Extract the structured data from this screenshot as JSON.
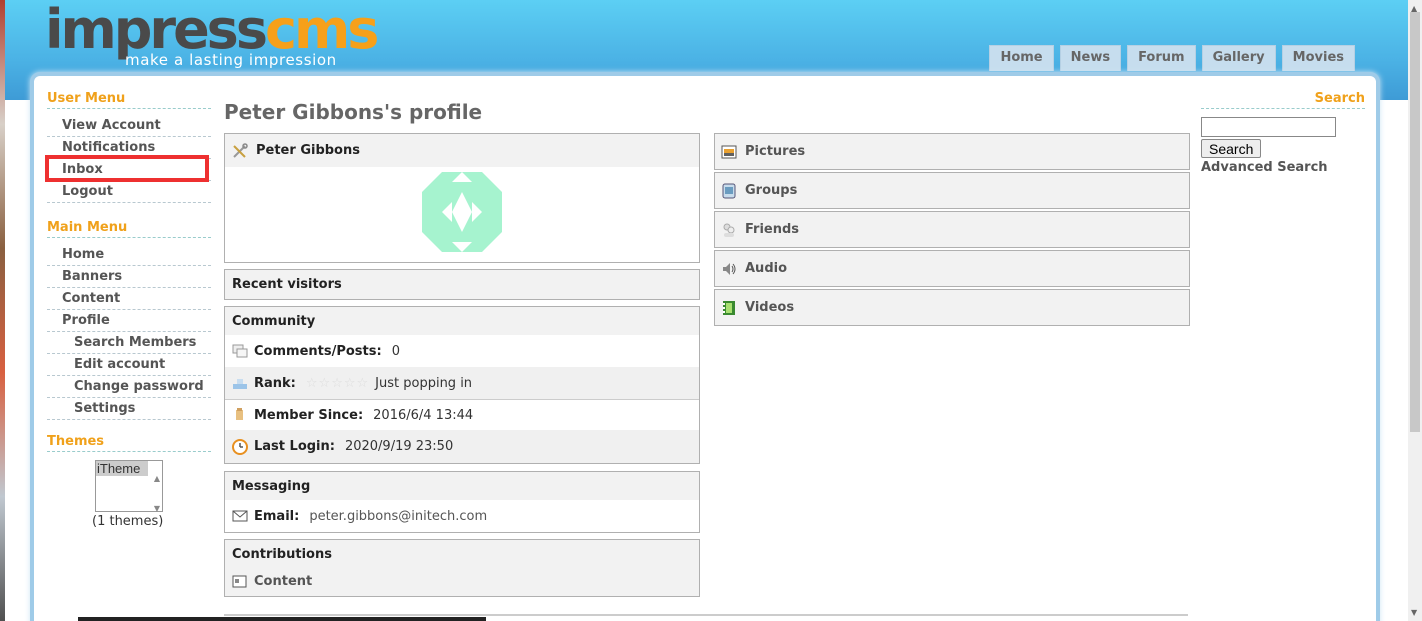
{
  "header": {
    "logo_main_1": "impress",
    "logo_main_2": "cms",
    "tagline": "make a lasting impression",
    "nav": [
      "Home",
      "News",
      "Forum",
      "Gallery",
      "Movies"
    ]
  },
  "user_menu": {
    "title": "User Menu",
    "items": [
      "View Account",
      "Notifications",
      "Inbox",
      "Logout"
    ]
  },
  "main_menu": {
    "title": "Main Menu",
    "items": [
      "Home",
      "Banners",
      "Content",
      "Profile"
    ],
    "sub_items": [
      "Search Members",
      "Edit account",
      "Change password",
      "Settings"
    ]
  },
  "themes": {
    "title": "Themes",
    "selected": "iTheme",
    "count": "(1 themes)"
  },
  "search": {
    "title": "Search",
    "button": "Search",
    "advanced": "Advanced Search",
    "value": ""
  },
  "profile": {
    "title": "Peter Gibbons's profile",
    "name": "Peter Gibbons",
    "recent_visitors": "Recent visitors",
    "community": {
      "title": "Community",
      "comments_label": "Comments/Posts:",
      "comments_value": "0",
      "rank_label": "Rank:",
      "rank_stars": "☆☆☆☆☆",
      "rank_value": "Just popping in",
      "since_label": "Member Since:",
      "since_value": "2016/6/4 13:44",
      "login_label": "Last Login:",
      "login_value": "2020/9/19 23:50"
    },
    "messaging": {
      "title": "Messaging",
      "email_label": "Email:",
      "email_value": "peter.gibbons@initech.com"
    },
    "contributions": {
      "title": "Contributions",
      "content": "Content"
    }
  },
  "media": [
    "Pictures",
    "Groups",
    "Friends",
    "Audio",
    "Videos"
  ],
  "colors": {
    "accent": "#f0a11b",
    "header": "#4bb2e5",
    "highlight": "#ee3030",
    "avatar": "#a6f3cf"
  }
}
